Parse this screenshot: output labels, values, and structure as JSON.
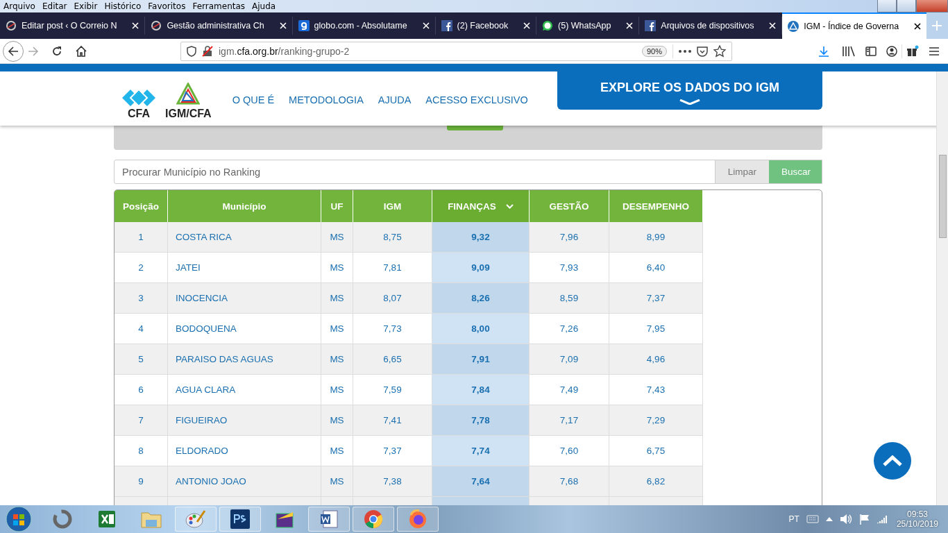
{
  "menu_bar": [
    "Arquivo",
    "Editar",
    "Exibir",
    "Histórico",
    "Favoritos",
    "Ferramentas",
    "Ajuda"
  ],
  "tabs": [
    {
      "title": "Editar post ‹ O Correio N",
      "kind": "wordpress",
      "selected": false
    },
    {
      "title": "Gestão administrativa Ch",
      "kind": "wordpress",
      "selected": false
    },
    {
      "title": "globo.com - Absolutame",
      "kind": "globo",
      "selected": false
    },
    {
      "title": "(2) Facebook",
      "kind": "facebook",
      "selected": false
    },
    {
      "title": "(5) WhatsApp",
      "kind": "whatsapp",
      "selected": false
    },
    {
      "title": "Arquivos de dispositivos",
      "kind": "facebook",
      "selected": false
    },
    {
      "title": "IGM - Índice de Governa",
      "kind": "igm",
      "selected": true
    }
  ],
  "address_bar": {
    "subdomain": "igm.",
    "domain": "cfa.org.br",
    "path": "/ranking-grupo-2",
    "zoom": "90%"
  },
  "site_header": {
    "logos": [
      "CFA",
      "IGM/CFA"
    ],
    "nav": [
      "O QUE É",
      "METODOLOGIA",
      "AJUDA",
      "ACESSO EXCLUSIVO"
    ],
    "explore_button": "EXPLORE OS DADOS DO IGM"
  },
  "search": {
    "placeholder": "Procurar Município no Ranking",
    "buttons": [
      "Limpar",
      "Buscar"
    ]
  },
  "table": {
    "columns": [
      {
        "label": "Posição",
        "sorted": false
      },
      {
        "label": "Município",
        "sorted": false
      },
      {
        "label": "UF",
        "sorted": false
      },
      {
        "label": "IGM",
        "sorted": false
      },
      {
        "label": "FINANÇAS",
        "sorted": true
      },
      {
        "label": "GESTÃO",
        "sorted": false
      },
      {
        "label": "DESEMPENHO",
        "sorted": false
      }
    ],
    "rows": [
      [
        "1",
        "COSTA RICA",
        "MS",
        "8,75",
        "9,32",
        "7,96",
        "8,99"
      ],
      [
        "2",
        "JATEI",
        "MS",
        "7,81",
        "9,09",
        "7,93",
        "6,40"
      ],
      [
        "3",
        "INOCENCIA",
        "MS",
        "8,07",
        "8,26",
        "8,59",
        "7,37"
      ],
      [
        "4",
        "BODOQUENA",
        "MS",
        "7,73",
        "8,00",
        "7,26",
        "7,95"
      ],
      [
        "5",
        "PARAISO DAS AGUAS",
        "MS",
        "6,65",
        "7,91",
        "7,09",
        "4,96"
      ],
      [
        "6",
        "AGUA CLARA",
        "MS",
        "7,59",
        "7,84",
        "7,49",
        "7,43"
      ],
      [
        "7",
        "FIGUEIRAO",
        "MS",
        "7,41",
        "7,78",
        "7,17",
        "7,29"
      ],
      [
        "8",
        "ELDORADO",
        "MS",
        "7,37",
        "7,74",
        "7,60",
        "6,75"
      ],
      [
        "9",
        "ANTONIO JOAO",
        "MS",
        "7,38",
        "7,64",
        "7,68",
        "6,82"
      ]
    ]
  },
  "taskbar": {
    "language": "PT",
    "time": "09:53",
    "date": "25/10/2019"
  }
}
